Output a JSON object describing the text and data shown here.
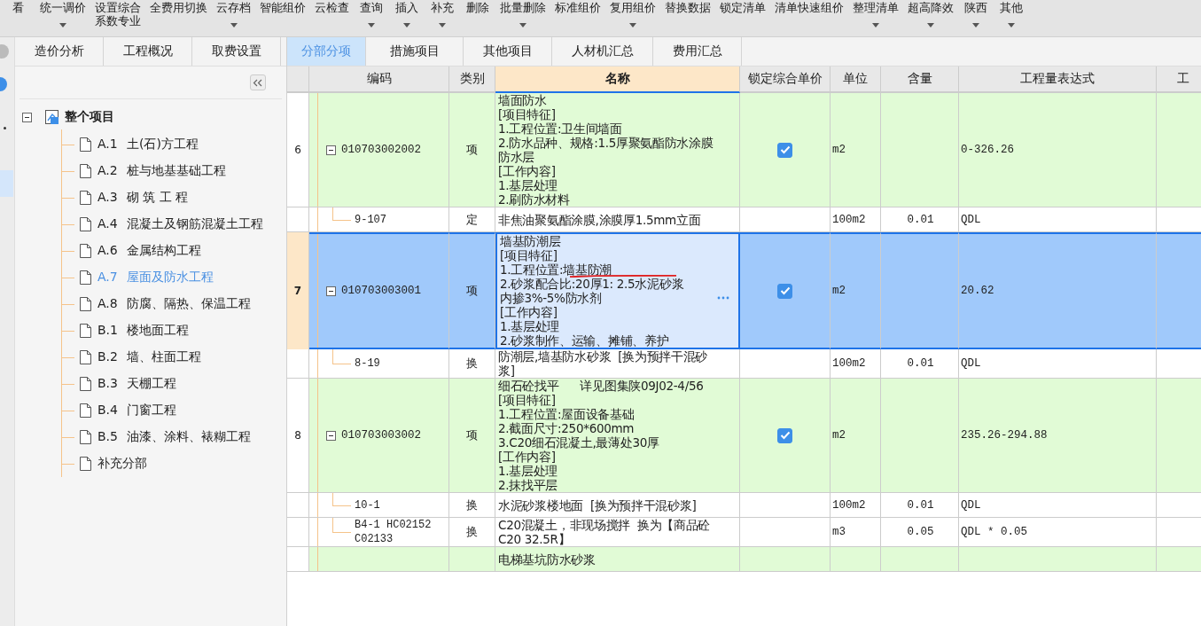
{
  "toolbar": [
    {
      "label": "看",
      "dropdown": false
    },
    {
      "label": "统一调价",
      "dropdown": true
    },
    {
      "label": "设置综合",
      "sublabel": "系数专业",
      "dropdown": false
    },
    {
      "label": "全费用切换",
      "dropdown": false
    },
    {
      "label": "云存档",
      "dropdown": true
    },
    {
      "label": "智能组价",
      "dropdown": false
    },
    {
      "label": "云检查",
      "dropdown": false
    },
    {
      "label": "查询",
      "dropdown": true
    },
    {
      "label": "插入",
      "dropdown": true
    },
    {
      "label": "补充",
      "dropdown": true
    },
    {
      "label": "删除",
      "dropdown": false
    },
    {
      "label": "批量删除",
      "dropdown": true
    },
    {
      "label": "标准组价",
      "dropdown": false
    },
    {
      "label": "复用组价",
      "dropdown": true
    },
    {
      "label": "替换数据",
      "dropdown": false
    },
    {
      "label": "锁定清单",
      "dropdown": false
    },
    {
      "label": "清单快速组价",
      "dropdown": false
    },
    {
      "label": "整理清单",
      "dropdown": true
    },
    {
      "label": "超高降效",
      "dropdown": true
    },
    {
      "label": "陕西",
      "dropdown": true
    },
    {
      "label": "其他",
      "dropdown": true
    }
  ],
  "tabs": [
    {
      "label": "造价分析",
      "selected": false
    },
    {
      "label": "工程概况",
      "selected": false
    },
    {
      "label": "取费设置",
      "selected": false
    },
    {
      "label": "分部分项",
      "selected": true
    },
    {
      "label": "措施项目",
      "selected": false
    },
    {
      "label": "其他项目",
      "selected": false
    },
    {
      "label": "人材机汇总",
      "selected": false
    },
    {
      "label": "费用汇总",
      "selected": false
    }
  ],
  "tree": {
    "label": "整个项目",
    "expanded": true,
    "children": [
      {
        "code": "A.1",
        "name": "土(石)方工程",
        "selected": false
      },
      {
        "code": "A.2",
        "name": "桩与地基基础工程",
        "selected": false
      },
      {
        "code": "A.3",
        "name": "砌 筑 工 程",
        "selected": false
      },
      {
        "code": "A.4",
        "name": "混凝土及钢筋混凝土工程",
        "selected": false
      },
      {
        "code": "A.6",
        "name": "金属结构工程",
        "selected": false
      },
      {
        "code": "A.7",
        "name": "屋面及防水工程",
        "selected": true
      },
      {
        "code": "A.8",
        "name": "防腐、隔热、保温工程",
        "selected": false
      },
      {
        "code": "B.1",
        "name": "楼地面工程",
        "selected": false
      },
      {
        "code": "B.2",
        "name": "墙、柱面工程",
        "selected": false
      },
      {
        "code": "B.3",
        "name": "天棚工程",
        "selected": false
      },
      {
        "code": "B.4",
        "name": "门窗工程",
        "selected": false
      },
      {
        "code": "B.5",
        "name": "油漆、涂料、裱糊工程",
        "selected": false
      },
      {
        "name": "补充分部",
        "selected": false
      }
    ]
  },
  "table": {
    "columns": [
      "编码",
      "类别",
      "名称",
      "锁定综合单价",
      "单位",
      "含量",
      "工程量表达式",
      "工"
    ],
    "rows": [
      {
        "kind": "list",
        "number": "6",
        "code": "010703002002",
        "expanded": true,
        "type": "项",
        "name": [
          "墙面防水",
          "[项目特征]",
          "1.工程位置:卫生间墙面",
          "2.防水品种、规格:1.5厚聚氨酯防水涂膜",
          "防水层",
          "[工作内容]",
          "1.基层处理",
          "2.刷防水材料"
        ],
        "locked": true,
        "unit": "m2",
        "amount": "",
        "expression": "0-326.26",
        "selected": false
      },
      {
        "kind": "quota",
        "code": "9-107",
        "type": "定",
        "name": [
          "非焦油聚氨酯涂膜,涂膜厚1.5mm立面"
        ],
        "unit": "100m2",
        "amount": "0.01",
        "expression": "QDL",
        "selected": false
      },
      {
        "kind": "list",
        "number": "7",
        "code": "010703003001",
        "expanded": true,
        "type": "项",
        "name": [
          "墙基防潮层",
          "[项目特征]",
          "1.工程位置:墙基防潮",
          "2.砂浆配合比:20厚1: 2.5水泥砂浆",
          "内掺3%-5%防水剂",
          "[工作内容]",
          "1.基层处理",
          "2.砂浆制作、运输、摊铺、养护"
        ],
        "locked": true,
        "unit": "m2",
        "amount": "",
        "expression": "20.62",
        "selected": true
      },
      {
        "kind": "quota",
        "code": "8-19",
        "type": "换",
        "name": [
          "防潮层,墙基防水砂浆  [换为预拌干混砂",
          "浆]"
        ],
        "unit": "100m2",
        "amount": "0.01",
        "expression": "QDL",
        "selected": false
      },
      {
        "kind": "list",
        "number": "8",
        "code": "010703003002",
        "expanded": true,
        "type": "项",
        "name": [
          "细石砼找平      详见图集陕09J02-4/56",
          "[项目特征]",
          "1.工程位置:屋面设备基础",
          "2.截面尺寸:250*600mm",
          "3.C20细石混凝土,最薄处30厚",
          "[工作内容]",
          "1.基层处理",
          "2.抹找平层"
        ],
        "locked": true,
        "unit": "m2",
        "amount": "",
        "expression": "235.26-294.88",
        "selected": false
      },
      {
        "kind": "quota",
        "code": "10-1",
        "type": "换",
        "name": [
          "水泥砂浆楼地面  [换为预拌干混砂浆]"
        ],
        "unit": "100m2",
        "amount": "0.01",
        "expression": "QDL",
        "selected": false
      },
      {
        "kind": "quota",
        "code": "B4-1 HC02152 C02133",
        "type": "换",
        "name": [
          "C20混凝土，非现场搅拌  换为【商品砼",
          "C20 32.5R】"
        ],
        "unit": "m3",
        "amount": "0.05",
        "expression": "QDL * 0.05",
        "selected": false
      },
      {
        "kind": "list",
        "name": [
          "电梯基坑防水砂浆"
        ],
        "selected": false
      }
    ]
  }
}
